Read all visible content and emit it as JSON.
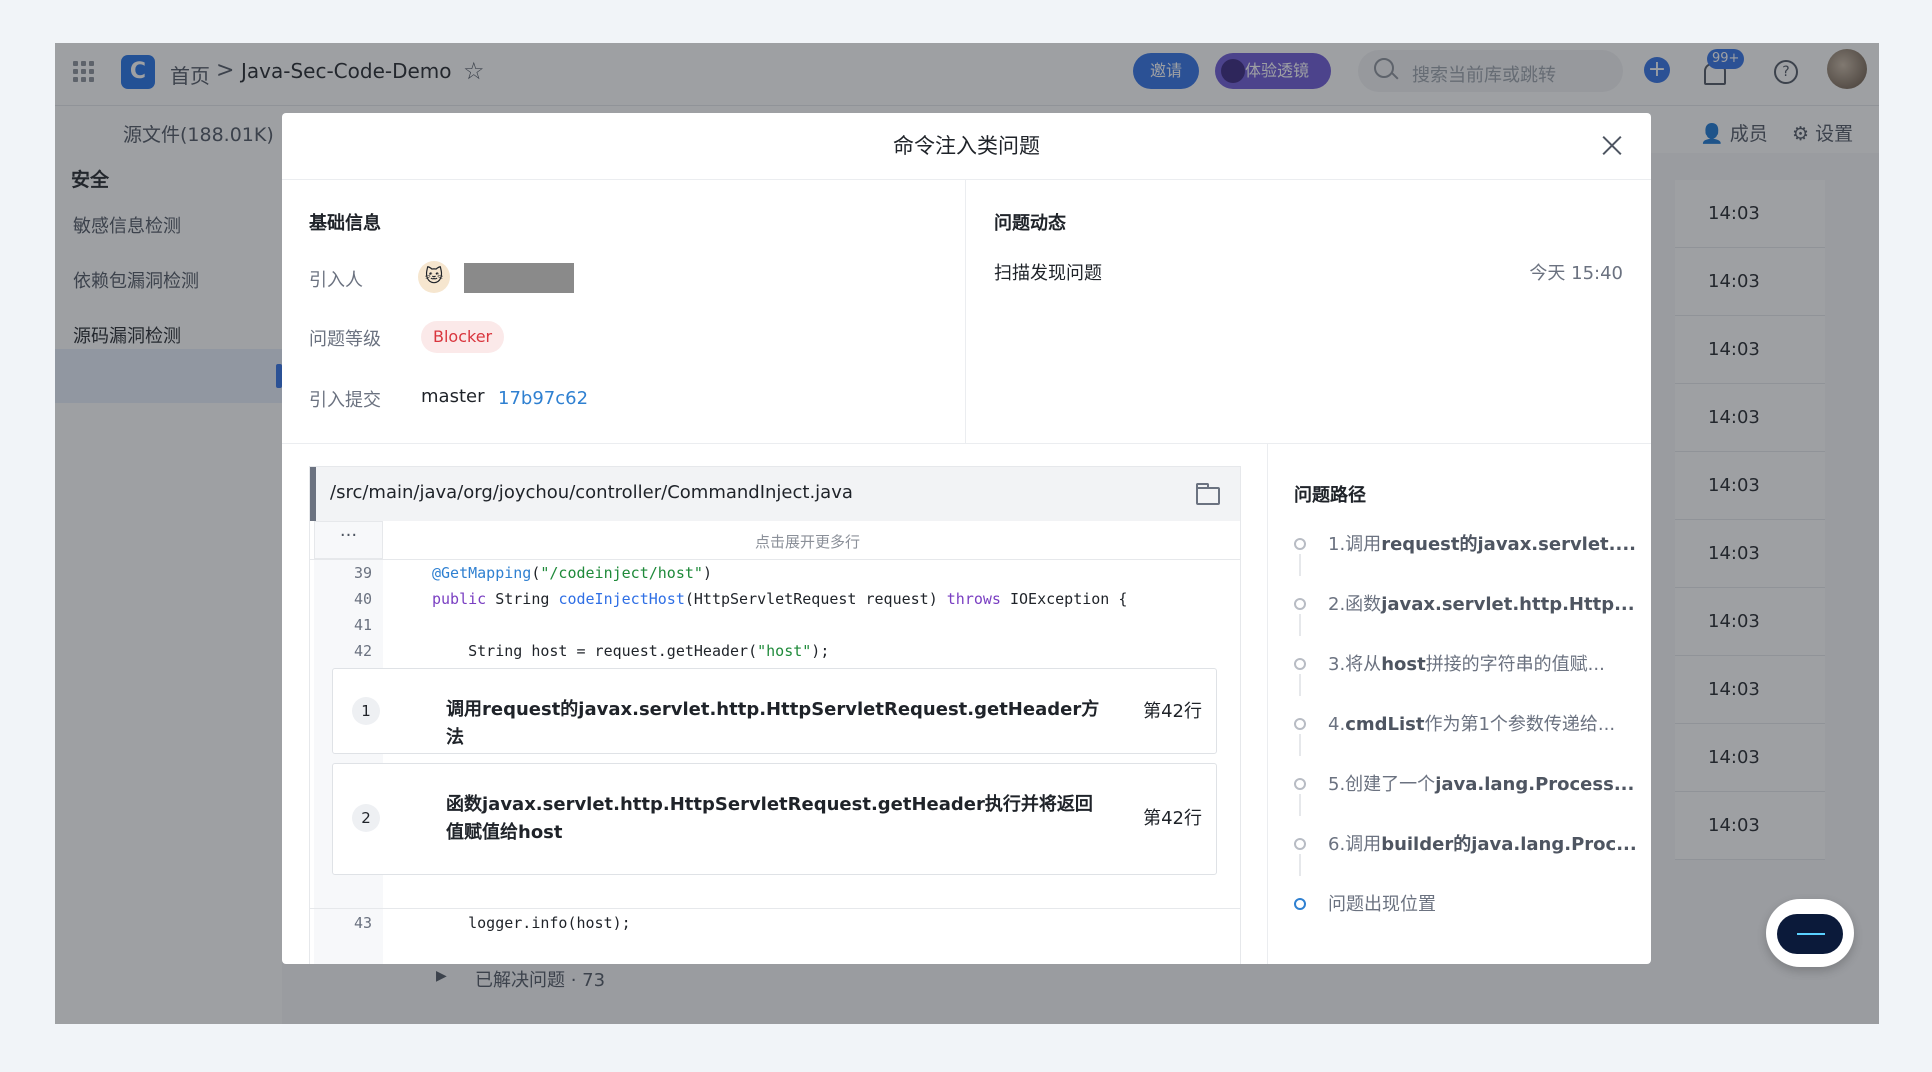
{
  "topbar": {
    "home": "首页",
    "separator": ">",
    "repo": "Java-Sec-Code-Demo",
    "invite": "邀请",
    "lens": "体验透镜",
    "search_placeholder": "搜索当前库或跳转",
    "notifications": "99+"
  },
  "subnav": {
    "source": "源文件(188.01K)",
    "members": "成员",
    "settings": "设置"
  },
  "left_nav": {
    "heading": "安全",
    "items": [
      {
        "label": "敏感信息检测"
      },
      {
        "label": "依赖包漏洞检测"
      },
      {
        "label": "源码漏洞检测",
        "active": true
      }
    ]
  },
  "background_list": {
    "times": [
      "14:03",
      "14:03",
      "14:03",
      "14:03",
      "14:03",
      "14:03",
      "14:03",
      "14:03",
      "14:03",
      "14:03"
    ],
    "resolved": "已解决问题 · 73"
  },
  "modal": {
    "title": "命令注入类问题",
    "basic_info": {
      "title": "基础信息",
      "reporter_label": "引入人",
      "level_label": "问题等级",
      "level_value": "Blocker",
      "commit_label": "引入提交",
      "branch": "master",
      "commit_hash": "17b97c62"
    },
    "activity": {
      "title": "问题动态",
      "items": [
        {
          "text": "扫描发现问题",
          "time": "今天 15:40"
        }
      ]
    },
    "code": {
      "file_path": "/src/main/java/org/joychou/controller/CommandInject.java",
      "expand_dots": "···",
      "expand_text": "点击展开更多行",
      "lines": [
        {
          "num": "39",
          "text": "@GetMapping(\"/codeinject/host\")"
        },
        {
          "num": "40",
          "text": "public String codeInjectHost(HttpServletRequest request) throws IOException {"
        },
        {
          "num": "41",
          "text": ""
        },
        {
          "num": "42",
          "text": "    String host = request.getHeader(\"host\");"
        },
        {
          "num": "43",
          "text": "    logger.info(host);"
        }
      ],
      "steps": [
        {
          "num": "1",
          "text": "调用request的javax.servlet.http.HttpServletRequest.getHeader方法",
          "line": "第42行"
        },
        {
          "num": "2",
          "text": "函数javax.servlet.http.HttpServletRequest.getHeader执行并将返回值赋值给host",
          "line": "第42行"
        }
      ]
    },
    "issue_path": {
      "title": "问题路径",
      "items": [
        {
          "prefix": "1.调用",
          "bold": "request的javax.servlet....",
          "suffix": ""
        },
        {
          "prefix": "2.函数",
          "bold": "javax.servlet.http.Http...",
          "suffix": ""
        },
        {
          "prefix": "3.将从",
          "bold": "host",
          "suffix": "拼接的字符串的值赋..."
        },
        {
          "prefix": "4.",
          "bold": "cmdList",
          "suffix": "作为第1个参数传递给..."
        },
        {
          "prefix": "5.创建了一个",
          "bold": "java.lang.Process...",
          "suffix": ""
        },
        {
          "prefix": "6.调用",
          "bold": "builder的java.lang.Proc...",
          "suffix": ""
        }
      ],
      "final": "问题出现位置"
    }
  }
}
